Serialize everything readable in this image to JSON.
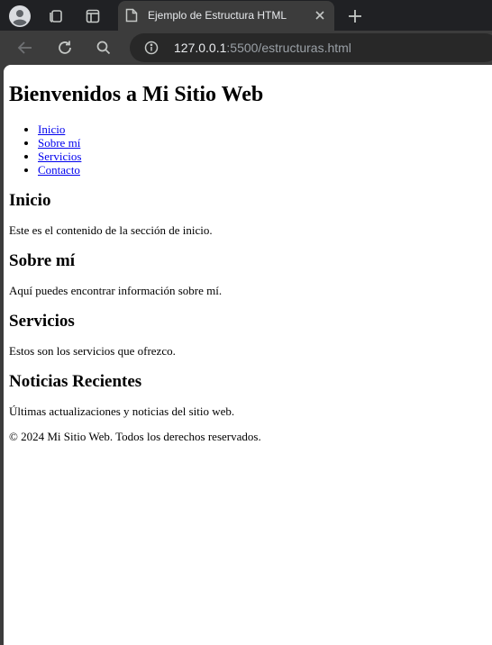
{
  "browser": {
    "tab_title": "Ejemplo de Estructura HTML",
    "url_host": "127.0.0.1",
    "url_rest": ":5500/estructuras.html"
  },
  "page": {
    "heading": "Bienvenidos a Mi Sitio Web",
    "nav": [
      "Inicio",
      "Sobre mí",
      "Servicios",
      "Contacto"
    ],
    "sections": [
      {
        "title": "Inicio",
        "text": "Este es el contenido de la sección de inicio."
      },
      {
        "title": "Sobre mí",
        "text": "Aquí puedes encontrar información sobre mí."
      },
      {
        "title": "Servicios",
        "text": "Estos son los servicios que ofrezco."
      },
      {
        "title": "Noticias Recientes",
        "text": "Últimas actualizaciones y noticias del sitio web."
      }
    ],
    "footer": "© 2024 Mi Sitio Web. Todos los derechos reservados."
  }
}
